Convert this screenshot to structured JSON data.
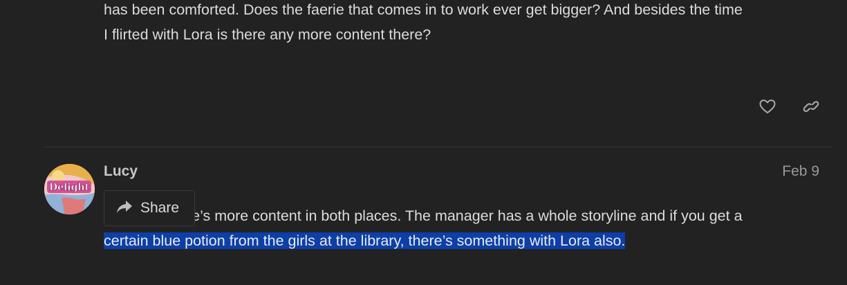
{
  "previous_post": {
    "lines": [
      "has been comforted. Does the faerie that comes in to work ever get bigger? And besides the time",
      "I flirted with Lora is there any more content there?"
    ]
  },
  "reply": {
    "username": "Lucy",
    "date": "Feb 9",
    "line1_visible": "re’s more content in both places. The manager has a whole storyline and if you get a",
    "line2_selected": "certain blue potion from the girls at the library, there’s something with Lora also."
  },
  "share_popup": {
    "label": "Share"
  },
  "avatar": {
    "text": "Delight"
  },
  "icons": {
    "like": "heart-icon",
    "copy_link": "link-icon",
    "share": "share-arrow-icon"
  },
  "colors": {
    "background": "#222222",
    "text": "#dcdcdc",
    "muted": "#9a9a9a",
    "selection": "#0c3fa8",
    "divider": "#3a3a3a"
  }
}
